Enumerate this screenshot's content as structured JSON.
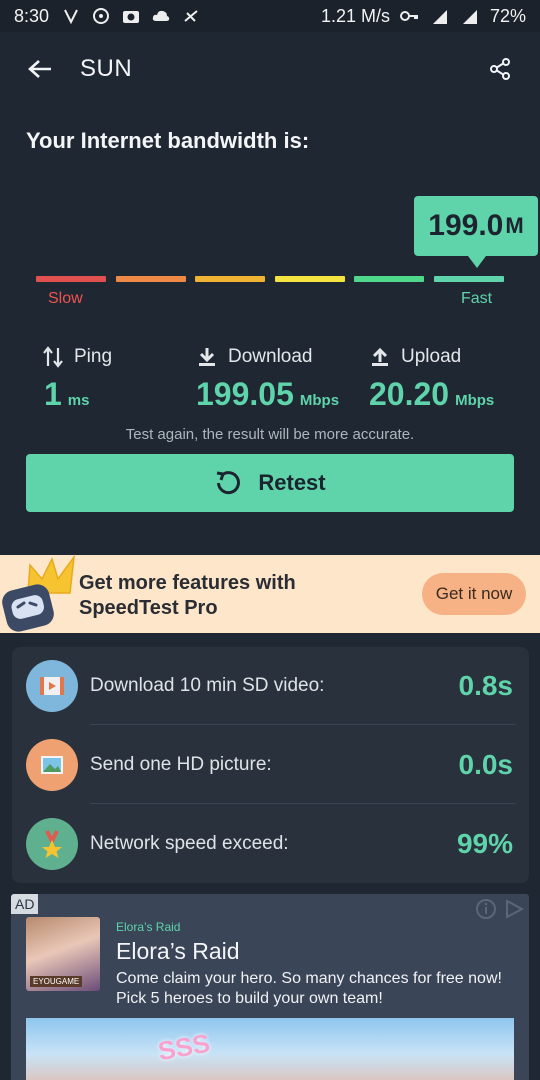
{
  "status_bar": {
    "time": "8:30",
    "net_speed": "1.21 M/s",
    "battery": "72%"
  },
  "app_bar": {
    "title": "SUN"
  },
  "headline": "Your Internet bandwidth is:",
  "gauge": {
    "value": "199.0",
    "unit": "M",
    "slow_label": "Slow",
    "fast_label": "Fast",
    "segment_colors": [
      "#e0504f",
      "#ee8a46",
      "#f1b334",
      "#f4e23f",
      "#4fd78a",
      "#5fd3a9"
    ]
  },
  "metrics": {
    "ping": {
      "label": "Ping",
      "value": "1",
      "unit": "ms"
    },
    "download": {
      "label": "Download",
      "value": "199.05",
      "unit": "Mbps"
    },
    "upload": {
      "label": "Upload",
      "value": "20.20",
      "unit": "Mbps"
    }
  },
  "hint": "Test again, the result will be more accurate.",
  "retest_label": "Retest",
  "promo": {
    "line1": "Get more features with",
    "line2": "SpeedTest Pro",
    "button": "Get it now"
  },
  "stats": [
    {
      "label": "Download 10 min SD video:",
      "value": "0.8s",
      "icon": "video-icon"
    },
    {
      "label": "Send one HD picture:",
      "value": "0.0s",
      "icon": "picture-icon"
    },
    {
      "label": "Network speed exceed:",
      "value": "99%",
      "icon": "medal-icon"
    }
  ],
  "ad": {
    "tag": "AD",
    "advertiser": "Elora’s Raid",
    "title": "Elora’s Raid",
    "description": "Come claim your hero. So many chances for free now! Pick 5 heroes to build your own team!",
    "thumb_brand": "EYOUGAME",
    "banner_text": "SSS"
  },
  "colors": {
    "background": "#1f2733",
    "accent": "#5fd3a9",
    "card": "#29313d",
    "promo_bg": "#fde6c9"
  }
}
